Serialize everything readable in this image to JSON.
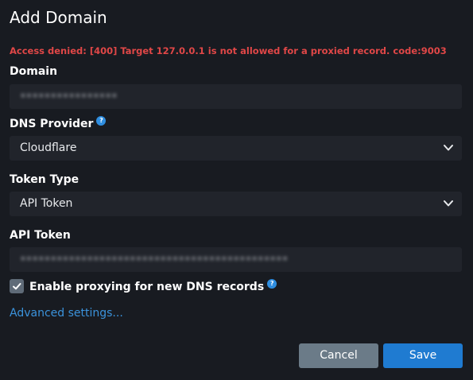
{
  "dialog": {
    "title": "Add Domain",
    "error": "Access denied: [400] Target 127.0.0.1 is not allowed for a proxied record. code:9003"
  },
  "domain": {
    "label": "Domain",
    "value": "••••••••••••••••"
  },
  "dns_provider": {
    "label": "DNS Provider",
    "help_icon": "question-circle-icon",
    "selected": "Cloudflare"
  },
  "token_type": {
    "label": "Token Type",
    "selected": "API Token"
  },
  "api_token": {
    "label": "API Token",
    "value": "••••••••••••••••••••••••••••••••••••••••••••"
  },
  "proxying": {
    "label": "Enable proxying for new DNS records",
    "checked": true,
    "help_icon": "question-circle-icon"
  },
  "advanced_link": "Advanced settings...",
  "buttons": {
    "cancel": "Cancel",
    "save": "Save"
  },
  "colors": {
    "background": "#181b21",
    "field": "#21242b",
    "error": "#e04747",
    "link": "#3b93dc",
    "save": "#1f7bd1",
    "cancel": "#6b7b88"
  }
}
